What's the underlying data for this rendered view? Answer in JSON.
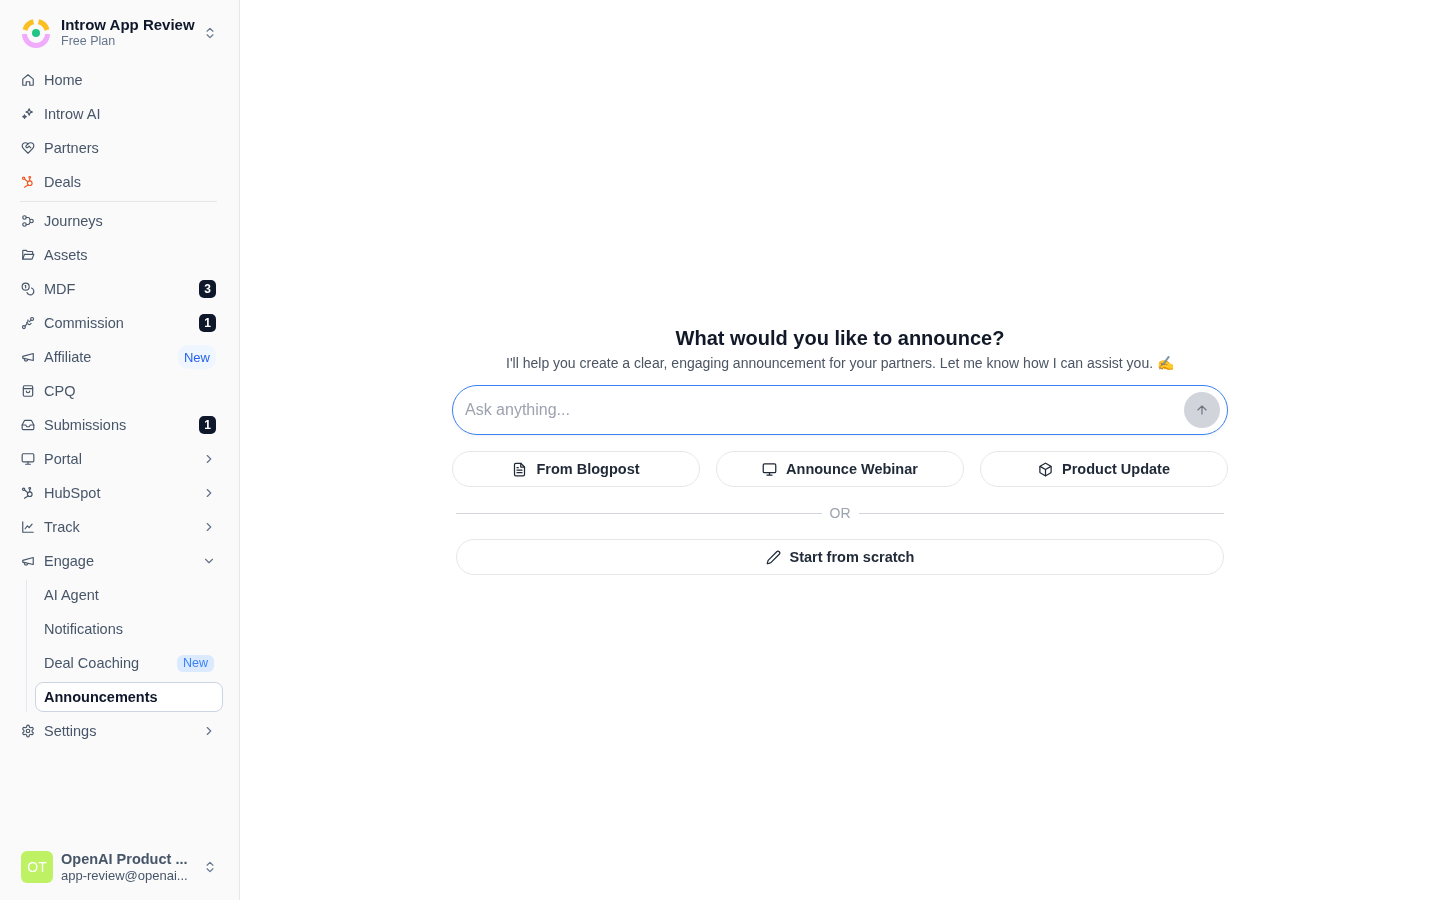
{
  "workspace": {
    "name": "Introw App Review",
    "plan": "Free Plan"
  },
  "nav_groups": [
    {
      "items": [
        {
          "label": "Home",
          "kind": "link",
          "selected": false
        },
        {
          "label": "Introw AI",
          "kind": "link",
          "selected": false
        },
        {
          "label": "Partners",
          "kind": "link",
          "selected": false
        },
        {
          "label": "Deals",
          "kind": "link",
          "selected": false
        }
      ]
    },
    {
      "items": [
        {
          "label": "Journeys",
          "kind": "link",
          "selected": false
        },
        {
          "label": "Assets",
          "kind": "link",
          "selected": false
        },
        {
          "label": "MDF",
          "kind": "link",
          "selected": false,
          "badge": {
            "text": "3",
            "kind": "count"
          }
        },
        {
          "label": "Commission",
          "kind": "link",
          "selected": false,
          "badge": {
            "text": "1",
            "kind": "count"
          }
        },
        {
          "label": "Affiliate",
          "kind": "link",
          "selected": false,
          "badge": {
            "text": "New",
            "kind": "pill"
          }
        },
        {
          "label": "CPQ",
          "kind": "link",
          "selected": false
        },
        {
          "label": "Submissions",
          "kind": "link",
          "selected": false,
          "badge": {
            "text": "1",
            "kind": "count"
          }
        },
        {
          "label": "Portal",
          "kind": "group",
          "selected": false,
          "expanded": false
        },
        {
          "label": "HubSpot",
          "kind": "group",
          "selected": false,
          "expanded": false
        },
        {
          "label": "Track",
          "kind": "group",
          "selected": false,
          "expanded": false
        },
        {
          "label": "Engage",
          "kind": "group",
          "selected": false,
          "expanded": true,
          "children": [
            {
              "label": "AI Agent",
              "selected": false
            },
            {
              "label": "Notifications",
              "selected": false
            },
            {
              "label": "Deal Coaching",
              "selected": false,
              "badge": {
                "text": "New",
                "kind": "tag"
              }
            },
            {
              "label": "Announcements",
              "selected": true
            }
          ]
        },
        {
          "label": "Settings",
          "kind": "group",
          "selected": false,
          "expanded": false
        }
      ]
    }
  ],
  "user": {
    "initials": "OT",
    "name": "OpenAI Product ...",
    "email": "app-review@openai..."
  },
  "composer": {
    "title": "What would you like to announce?",
    "subtitle": "I'll help you create a clear, engaging announcement for your partners. Let me know how I can assist you. ✍️",
    "input": {
      "placeholder": "Ask anything...",
      "focused": true
    },
    "send_button": {
      "disabled": true
    },
    "quick_actions": [
      {
        "label": "From Blogpost"
      },
      {
        "label": "Announce Webinar"
      },
      {
        "label": "Product Update"
      }
    ],
    "divider_label": "OR",
    "scratch_button": {
      "label": "Start from scratch"
    }
  }
}
